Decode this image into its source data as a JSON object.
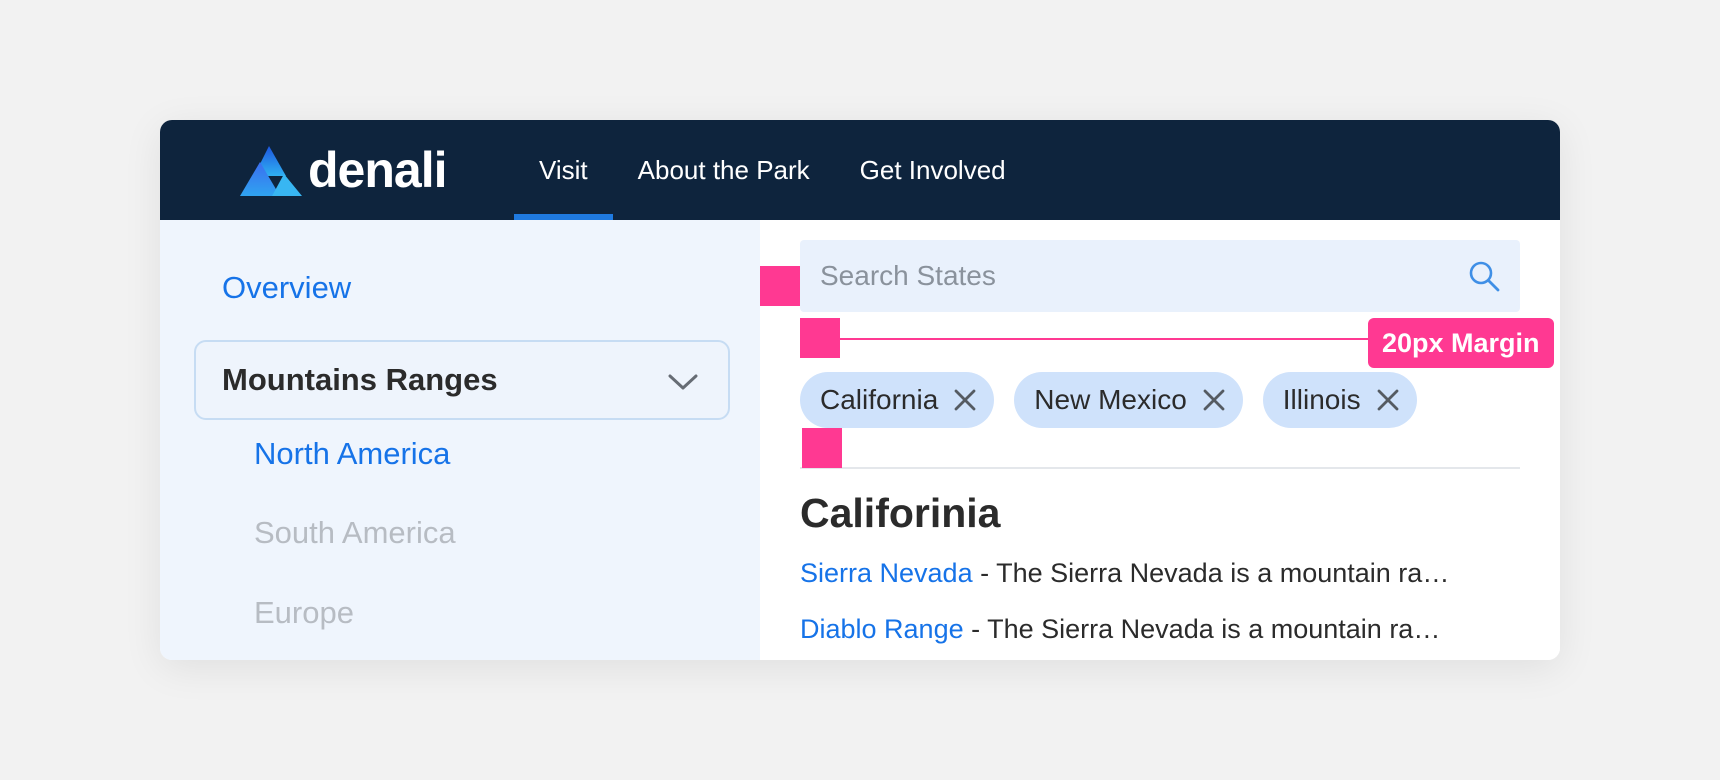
{
  "header": {
    "brand": "denali",
    "nav": [
      {
        "label": "Visit",
        "active": true
      },
      {
        "label": "About the Park",
        "active": false
      },
      {
        "label": "Get Involved",
        "active": false
      }
    ]
  },
  "sidebar": {
    "overview": "Overview",
    "dropdown_label": "Mountains Ranges",
    "items": [
      {
        "label": "North America",
        "state": "active"
      },
      {
        "label": "South America",
        "state": "muted"
      },
      {
        "label": "Europe",
        "state": "muted"
      }
    ]
  },
  "main": {
    "search": {
      "placeholder": "Search States",
      "value": ""
    },
    "chips": [
      "California",
      "New Mexico",
      "Illinois"
    ],
    "section_title": "Califorinia",
    "results": [
      {
        "link": "Sierra Nevada",
        "desc": " - The Sierra Nevada is a mountain ra…"
      },
      {
        "link": "Diablo Range",
        "desc": " - The Sierra Nevada is a mountain ra…"
      }
    ]
  },
  "annotations": {
    "margin_label": "20px Margin"
  },
  "colors": {
    "header_bg": "#0e243d",
    "accent": "#1673e8",
    "annotation": "#ff3992",
    "chip_bg": "#cfe2fb",
    "sidebar_bg": "#eff5fd"
  },
  "icons": {
    "logo": "mountain-logo-icon",
    "dropdown": "chevron-down-icon",
    "search": "search-icon",
    "chip_remove": "close-icon"
  }
}
